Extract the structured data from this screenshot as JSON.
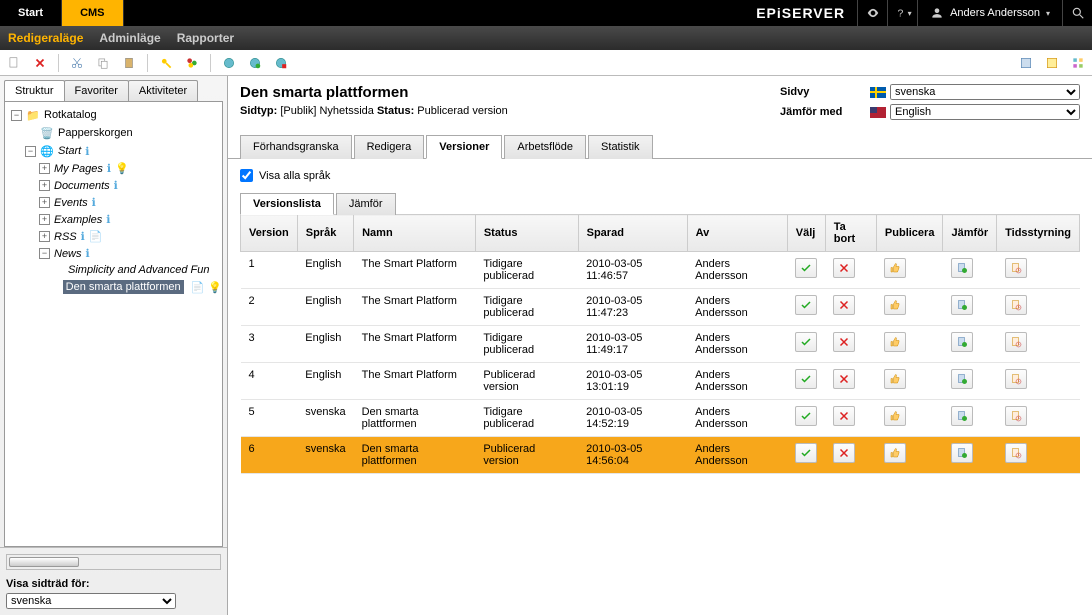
{
  "topbar": {
    "tabs": [
      "Start",
      "CMS"
    ],
    "active": 1,
    "logo": "EPiSERVER",
    "user": "Anders Andersson"
  },
  "modebar": {
    "items": [
      "Redigeraläge",
      "Adminläge",
      "Rapporter"
    ],
    "active": 0
  },
  "sidebar": {
    "tabs": [
      "Struktur",
      "Favoriter",
      "Aktiviteter"
    ],
    "active": 0,
    "root": "Rotkatalog",
    "recycle": "Papperskorgen",
    "start": "Start",
    "my_pages": "My Pages",
    "documents": "Documents",
    "events": "Events",
    "examples": "Examples",
    "rss": "RSS",
    "news": "News",
    "simplicity": "Simplicity and Advanced Fun",
    "den_smarta": "Den smarta plattformen",
    "show_tree_label": "Visa sidträd för:",
    "show_tree_value": "svenska"
  },
  "page": {
    "title": "Den smarta plattformen",
    "sidtyp_label": "Sidtyp:",
    "sidtyp_value": "[Publik] Nyhetssida",
    "status_label": "Status:",
    "status_value": "Publicerad version",
    "sidvy_label": "Sidvy",
    "sidvy_value": "svenska",
    "jamfor_label": "Jämför med",
    "jamfor_value": "English",
    "tabs": [
      "Förhandsgranska",
      "Redigera",
      "Versioner",
      "Arbetsflöde",
      "Statistik"
    ],
    "tabs_active": 2,
    "showall_label": "Visa alla språk",
    "inner_tabs": [
      "Versionslista",
      "Jämför"
    ],
    "inner_active": 0,
    "columns": [
      "Version",
      "Språk",
      "Namn",
      "Status",
      "Sparad",
      "Av",
      "Välj",
      "Ta bort",
      "Publicera",
      "Jämför",
      "Tidsstyrning"
    ],
    "rows": [
      {
        "version": "1",
        "lang": "English",
        "name": "The Smart Platform",
        "status": "Tidigare publicerad",
        "saved": "2010-03-05 11:46:57",
        "by": "Anders Andersson"
      },
      {
        "version": "2",
        "lang": "English",
        "name": "The Smart Platform",
        "status": "Tidigare publicerad",
        "saved": "2010-03-05 11:47:23",
        "by": "Anders Andersson"
      },
      {
        "version": "3",
        "lang": "English",
        "name": "The Smart Platform",
        "status": "Tidigare publicerad",
        "saved": "2010-03-05 11:49:17",
        "by": "Anders Andersson"
      },
      {
        "version": "4",
        "lang": "English",
        "name": "The Smart Platform",
        "status": "Publicerad version",
        "saved": "2010-03-05 13:01:19",
        "by": "Anders Andersson"
      },
      {
        "version": "5",
        "lang": "svenska",
        "name": "Den smarta plattformen",
        "status": "Tidigare publicerad",
        "saved": "2010-03-05 14:52:19",
        "by": "Anders Andersson"
      },
      {
        "version": "6",
        "lang": "svenska",
        "name": "Den smarta plattformen",
        "status": "Publicerad version",
        "saved": "2010-03-05 14:56:04",
        "by": "Anders Andersson"
      }
    ],
    "highlight_row": 5
  }
}
